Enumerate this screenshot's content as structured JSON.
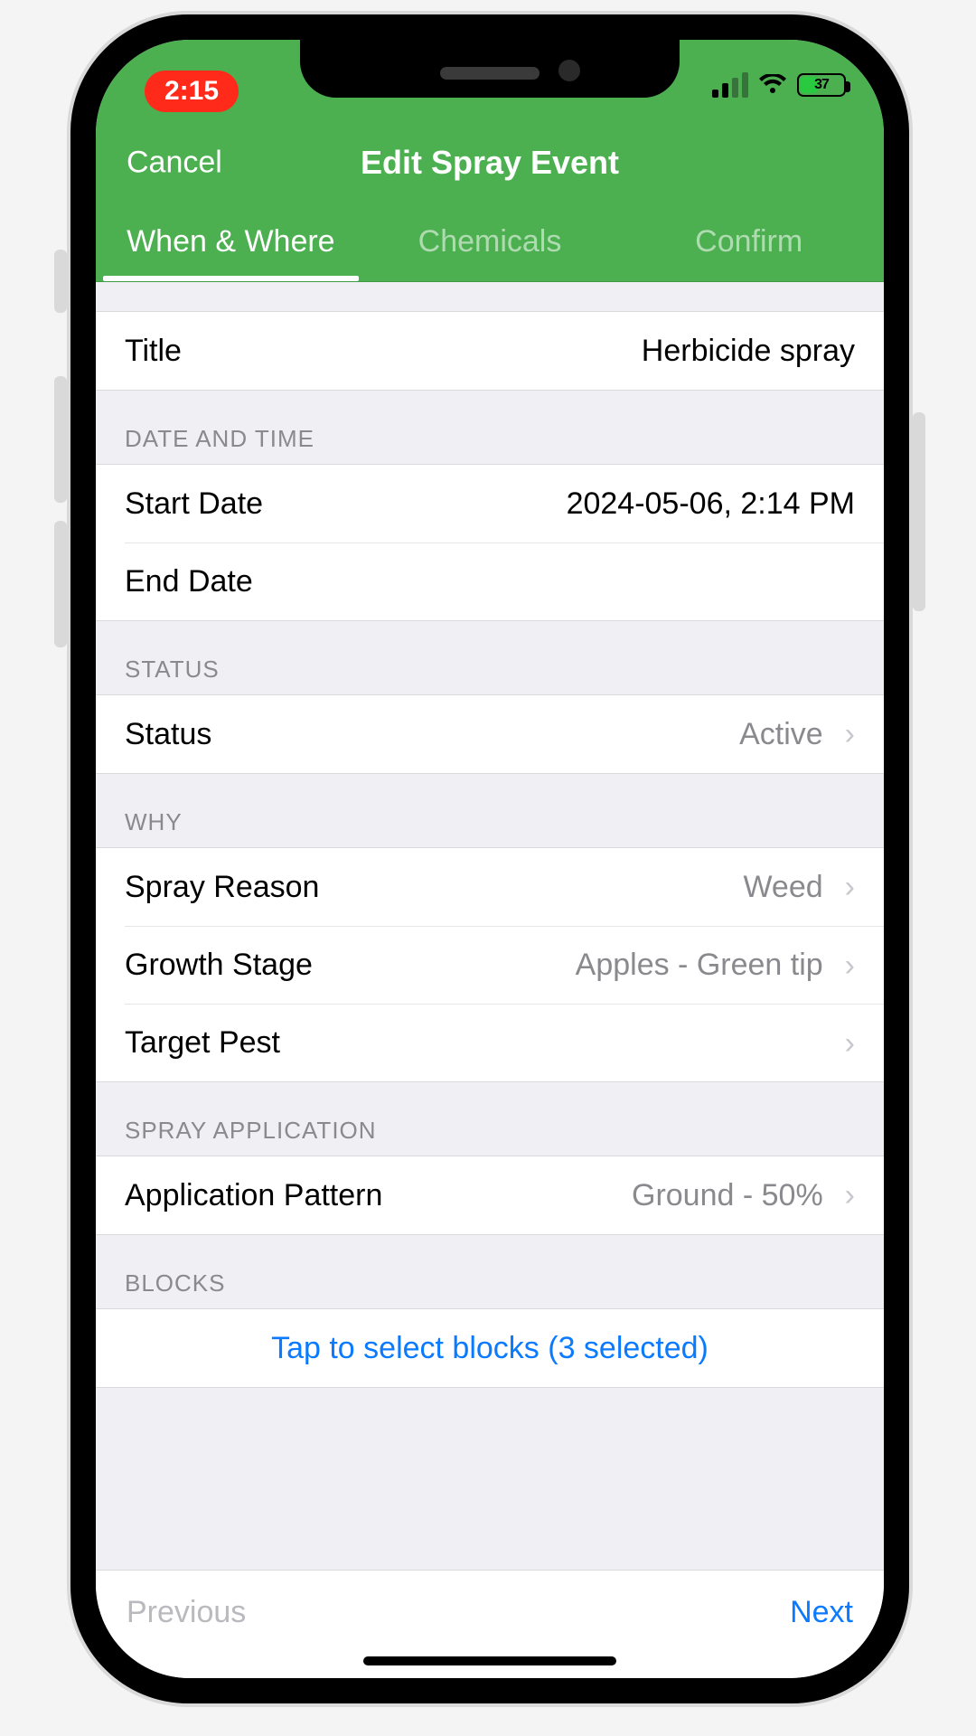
{
  "statusbar": {
    "time": "2:15",
    "battery_percent": "37"
  },
  "navbar": {
    "cancel": "Cancel",
    "title": "Edit Spray Event"
  },
  "tabs": {
    "when_where": "When & Where",
    "chemicals": "Chemicals",
    "confirm": "Confirm"
  },
  "title_row": {
    "label": "Title",
    "value": "Herbicide spray"
  },
  "sections": {
    "date_and_time": "DATE AND TIME",
    "status": "STATUS",
    "why": "WHY",
    "spray_application": "SPRAY APPLICATION",
    "blocks": "BLOCKS"
  },
  "date": {
    "start_label": "Start Date",
    "start_value": "2024-05-06, 2:14 PM",
    "end_label": "End Date",
    "end_value": ""
  },
  "status_row": {
    "label": "Status",
    "value": "Active"
  },
  "why": {
    "reason_label": "Spray Reason",
    "reason_value": "Weed",
    "growth_label": "Growth Stage",
    "growth_value": "Apples - Green tip",
    "pest_label": "Target Pest",
    "pest_value": ""
  },
  "application": {
    "pattern_label": "Application Pattern",
    "pattern_value": "Ground - 50%"
  },
  "blocks": {
    "link": "Tap to select blocks (3 selected)"
  },
  "toolbar": {
    "previous": "Previous",
    "next": "Next"
  },
  "colors": {
    "brand_green": "#4CAF50",
    "ios_blue": "#0a7aff",
    "record_red": "#ff2a1a"
  }
}
